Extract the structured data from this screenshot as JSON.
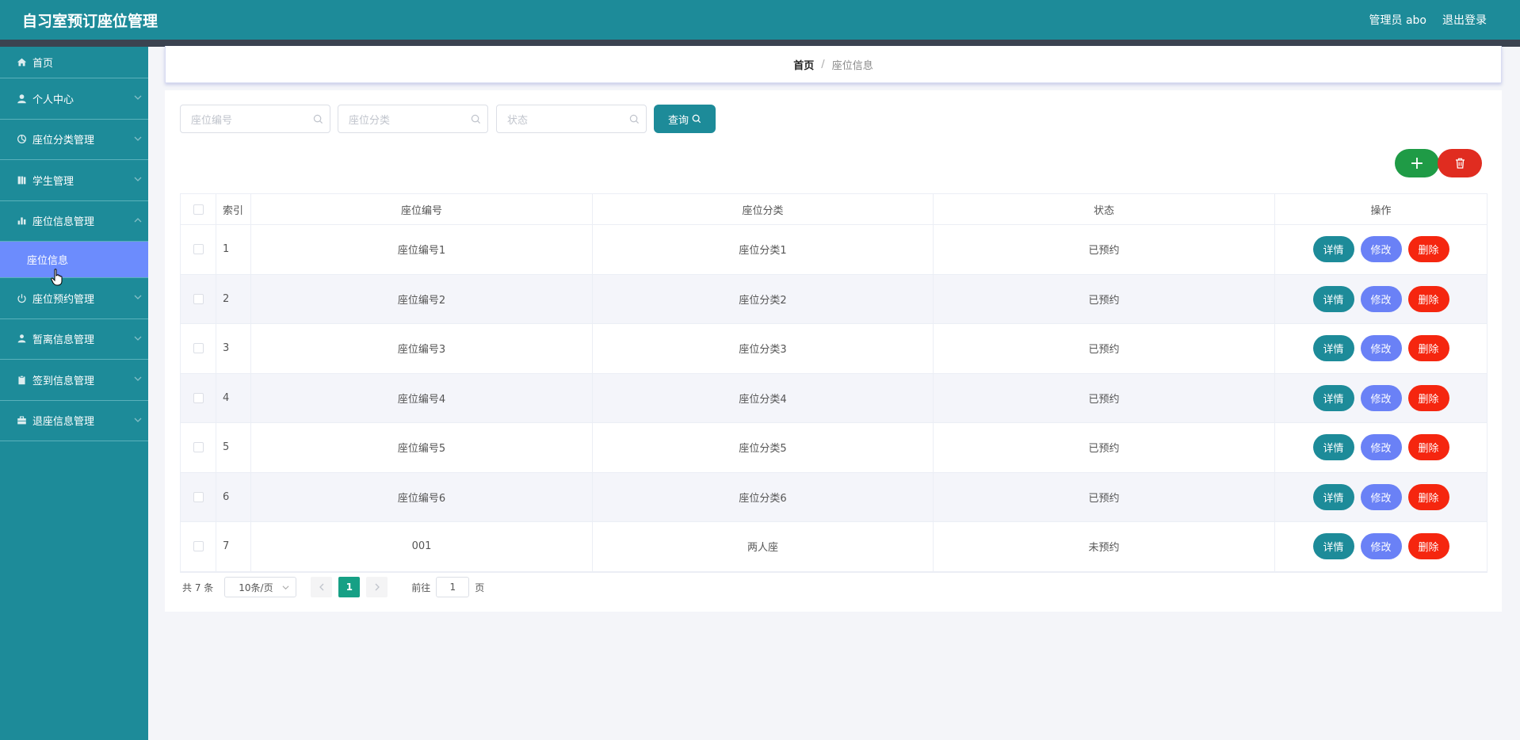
{
  "header": {
    "title": "自习室预订座位管理",
    "user": "管理员 abo",
    "logout": "退出登录"
  },
  "sidebar": {
    "items": [
      {
        "label": "首页",
        "icon": "home-icon"
      },
      {
        "label": "个人中心",
        "icon": "user-icon"
      },
      {
        "label": "座位分类管理",
        "icon": "category-icon"
      },
      {
        "label": "学生管理",
        "icon": "book-icon"
      },
      {
        "label": "座位信息管理",
        "icon": "bar-chart-icon"
      },
      {
        "label": "座位预约管理",
        "icon": "power-icon"
      },
      {
        "label": "暂离信息管理",
        "icon": "person-icon"
      },
      {
        "label": "签到信息管理",
        "icon": "clipboard-icon"
      },
      {
        "label": "退座信息管理",
        "icon": "briefcase-icon"
      }
    ],
    "active_sub": "座位信息"
  },
  "breadcrumb": {
    "home": "首页",
    "separator": "/",
    "current": "座位信息"
  },
  "search": {
    "seat_no_placeholder": "座位编号",
    "category_placeholder": "座位分类",
    "status_placeholder": "状态",
    "query_label": "查询"
  },
  "actions": {
    "add_symbol": "+"
  },
  "table": {
    "headers": {
      "index": "索引",
      "seat_no": "座位编号",
      "category": "座位分类",
      "status": "状态",
      "ops": "操作"
    },
    "row_buttons": {
      "detail": "详情",
      "edit": "修改",
      "delete": "删除"
    },
    "rows": [
      {
        "index": "1",
        "seat_no": "座位编号1",
        "category": "座位分类1",
        "status": "已预约"
      },
      {
        "index": "2",
        "seat_no": "座位编号2",
        "category": "座位分类2",
        "status": "已预约"
      },
      {
        "index": "3",
        "seat_no": "座位编号3",
        "category": "座位分类3",
        "status": "已预约"
      },
      {
        "index": "4",
        "seat_no": "座位编号4",
        "category": "座位分类4",
        "status": "已预约"
      },
      {
        "index": "5",
        "seat_no": "座位编号5",
        "category": "座位分类5",
        "status": "已预约"
      },
      {
        "index": "6",
        "seat_no": "座位编号6",
        "category": "座位分类6",
        "status": "已预约"
      },
      {
        "index": "7",
        "seat_no": "001",
        "category": "两人座",
        "status": "未预约"
      }
    ]
  },
  "pagination": {
    "total": "共 7 条",
    "page_size": "10条/页",
    "current_page": "1",
    "goto_label": "前往",
    "goto_value": "1",
    "page_unit": "页"
  },
  "colors": {
    "primary": "#1d8b99",
    "active_menu": "#6c8cfd",
    "add": "#1f9b46",
    "delete": "#f5260f",
    "edit": "#6a81f6"
  }
}
